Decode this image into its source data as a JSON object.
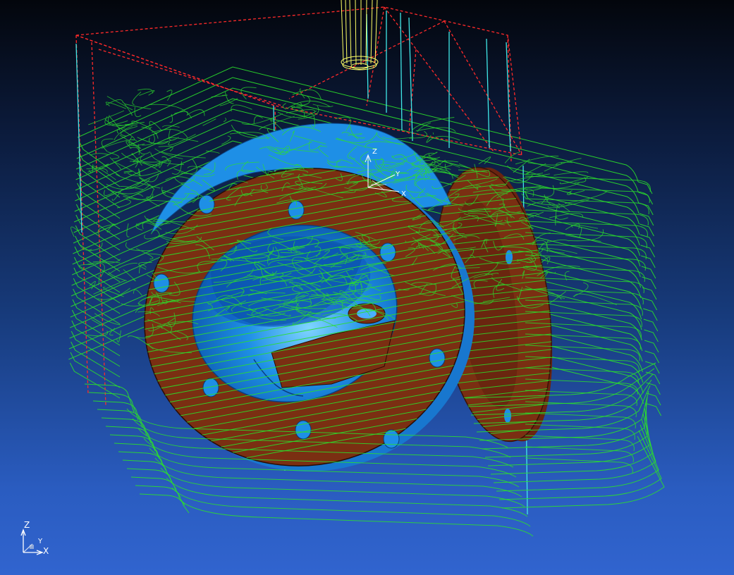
{
  "viewport": {
    "background_top": "#03060c",
    "background_bottom": "#3164cf"
  },
  "colors": {
    "toolpath": "#2be02b",
    "flange": "#7a2f12",
    "pocket": "#1e8fe6",
    "stock_box": "#ff2a2a",
    "tool": "#ffff66",
    "rapid": "#40e8e8"
  },
  "axes": {
    "z": "Z",
    "y": "Y",
    "x": "X"
  },
  "icons": {
    "main_triad": "axis-triad-icon",
    "model_triad": "model-axis-triad-icon",
    "tool": "end-mill-tool-icon"
  }
}
